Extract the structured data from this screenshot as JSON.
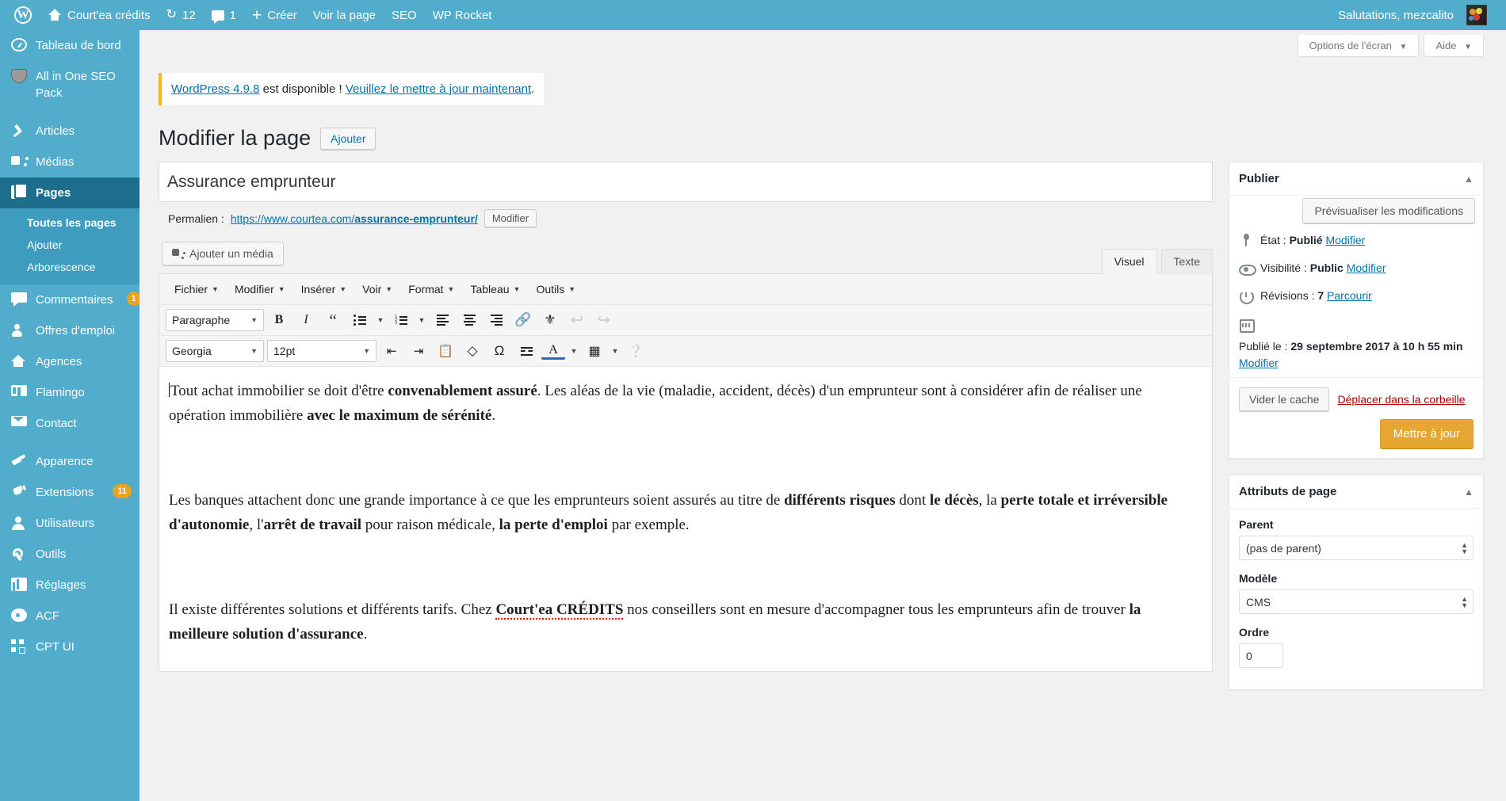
{
  "adminbar": {
    "logo_icon": "wordpress-logo-icon",
    "site_name": "Court'ea crédits",
    "updates_count": "12",
    "comments_count": "1",
    "new_label": "Créer",
    "view_page_label": "Voir la page",
    "seo_label": "SEO",
    "wp_rocket_label": "WP Rocket",
    "greeting": "Salutations, mezcalito"
  },
  "sidebar": {
    "items": [
      {
        "label": "Tableau de bord",
        "icon": "dashboard-icon"
      },
      {
        "label": "All in One SEO Pack",
        "icon": "shield-icon"
      },
      {
        "label": "Articles",
        "icon": "pin-icon"
      },
      {
        "label": "Médias",
        "icon": "media-icon"
      },
      {
        "label": "Pages",
        "icon": "pages-icon",
        "current": true
      },
      {
        "label": "Commentaires",
        "icon": "comment-icon",
        "badge": "1"
      },
      {
        "label": "Offres d'emploi",
        "icon": "jobs-icon"
      },
      {
        "label": "Agences",
        "icon": "agency-icon"
      },
      {
        "label": "Flamingo",
        "icon": "flamingo-icon"
      },
      {
        "label": "Contact",
        "icon": "mail-icon"
      },
      {
        "label": "Apparence",
        "icon": "brush-icon"
      },
      {
        "label": "Extensions",
        "icon": "plug-icon",
        "badge": "11"
      },
      {
        "label": "Utilisateurs",
        "icon": "user-icon"
      },
      {
        "label": "Outils",
        "icon": "wrench-icon"
      },
      {
        "label": "Réglages",
        "icon": "settings-icon"
      },
      {
        "label": "ACF",
        "icon": "gear-icon"
      },
      {
        "label": "CPT UI",
        "icon": "cpt-ui-icon"
      }
    ],
    "submenu": {
      "all_pages": "Toutes les pages",
      "add": "Ajouter",
      "tree": "Arborescence"
    }
  },
  "screen_meta": {
    "screen_options": "Options de l'écran",
    "help": "Aide"
  },
  "notice": {
    "link_version": "WordPress 4.9.8",
    "text_middle": " est disponible ! ",
    "link_update": "Veuillez le mettre à jour maintenant",
    "text_end": "."
  },
  "page": {
    "heading": "Modifier la page",
    "add_new": "Ajouter",
    "title_value": "Assurance emprunteur",
    "permalink_label": "Permalien :",
    "permalink_base": "https://www.courtea.com/",
    "permalink_slug": "assurance-emprunteur/",
    "permalink_edit": "Modifier"
  },
  "editor": {
    "add_media": "Ajouter un média",
    "tab_visual": "Visuel",
    "tab_text": "Texte",
    "menubar": [
      "Fichier",
      "Modifier",
      "Insérer",
      "Voir",
      "Format",
      "Tableau",
      "Outils"
    ],
    "format_select": "Paragraphe",
    "font_select": "Georgia",
    "size_select": "12pt",
    "toolbar_row1": [
      {
        "name": "bold-icon",
        "glyph": "B"
      },
      {
        "name": "italic-icon",
        "glyph": "I"
      },
      {
        "name": "blockquote-icon",
        "glyph": "“"
      },
      {
        "name": "bulleted-list-icon",
        "glyph": ""
      },
      {
        "name": "numbered-list-icon",
        "glyph": ""
      },
      {
        "name": "align-left-icon",
        "glyph": ""
      },
      {
        "name": "align-center-icon",
        "glyph": ""
      },
      {
        "name": "align-right-icon",
        "glyph": ""
      },
      {
        "name": "insert-link-icon",
        "glyph": ""
      },
      {
        "name": "remove-link-icon",
        "glyph": ""
      },
      {
        "name": "undo-icon",
        "glyph": "↶"
      },
      {
        "name": "redo-icon",
        "glyph": "↷"
      }
    ],
    "toolbar_row2": [
      {
        "name": "decrease-indent-icon"
      },
      {
        "name": "increase-indent-icon"
      },
      {
        "name": "paste-as-text-icon"
      },
      {
        "name": "clear-formatting-icon"
      },
      {
        "name": "special-character-icon",
        "glyph": "Ω"
      },
      {
        "name": "insert-read-more-icon"
      },
      {
        "name": "text-color-icon",
        "glyph": "A"
      },
      {
        "name": "table-icon"
      },
      {
        "name": "keyboard-shortcuts-icon",
        "glyph": "?"
      }
    ],
    "content": {
      "p1_a": "Tout achat immobilier se doit d'être ",
      "p1_b": "convenablement assuré",
      "p1_c": ". Les aléas de la vie (maladie, accident, décès) d'un emprunteur sont à considérer afin de réaliser une opération immobilière ",
      "p1_d": "avec le maximum de sérénité",
      "p1_e": ".",
      "p2_a": "Les banques attachent donc une grande importance à ce que les emprunteurs soient assurés au titre de ",
      "p2_b": "différents risques",
      "p2_c": " dont ",
      "p2_d": "le décès",
      "p2_e": ", la ",
      "p2_f": "perte totale et irréversible d'autonomie",
      "p2_g": ", l'",
      "p2_h": "arrêt de travail",
      "p2_i": " pour raison médicale, ",
      "p2_j": "la perte d'emploi",
      "p2_k": " par exemple.",
      "p3_a": "Il existe différentes solutions et différents tarifs. Chez ",
      "p3_b": "Court'ea CRÉDITS",
      "p3_c": " nos conseillers sont en mesure d'accompagner tous les emprunteurs afin de trouver ",
      "p3_d": "la meilleure solution d'assurance",
      "p3_e": "."
    }
  },
  "publish_box": {
    "title": "Publier",
    "preview_button": "Prévisualiser les modifications",
    "status_label": "État :",
    "status_value": "Publié",
    "status_edit": "Modifier",
    "visibility_label": "Visibilité :",
    "visibility_value": "Public",
    "visibility_edit": "Modifier",
    "revisions_label": "Révisions :",
    "revisions_value": "7",
    "revisions_browse": "Parcourir",
    "published_label": "Publié le :",
    "published_value": "29 septembre 2017 à 10 h 55 min",
    "published_edit": "Modifier",
    "clear_cache": "Vider le cache",
    "trash": "Déplacer dans la corbeille",
    "update": "Mettre à jour"
  },
  "attributes_box": {
    "title": "Attributs de page",
    "parent_label": "Parent",
    "parent_value": "(pas de parent)",
    "template_label": "Modèle",
    "template_value": "CMS",
    "order_label": "Ordre",
    "order_value": "0"
  },
  "colors": {
    "admin_blue": "#52accc",
    "admin_blue_dark": "#1d6d8c",
    "submenu_blue": "#3e9cbe",
    "link": "#0073aa",
    "badge": "#e8a321",
    "publish_button": "#e5a732",
    "trash_red": "#a00",
    "notice_accent": "#ffb900"
  }
}
